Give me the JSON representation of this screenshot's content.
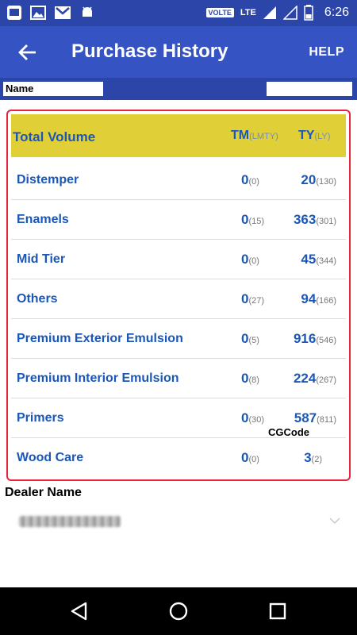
{
  "status_bar": {
    "volte": "VOLTE",
    "network": "LTE",
    "time": "6:26"
  },
  "app_bar": {
    "title": "Purchase History",
    "help_label": "HELP"
  },
  "name_field": {
    "label": "Name"
  },
  "table": {
    "header": {
      "label": "Total Volume",
      "tm": "TM",
      "tm_sub": "(LMTY)",
      "ty": "TY",
      "ty_sub": "(LY)"
    },
    "rows": [
      {
        "label": "Distemper",
        "tm": "0",
        "tm_sub": "(0)",
        "ty": "20",
        "ty_sub": "(130)"
      },
      {
        "label": "Enamels",
        "tm": "0",
        "tm_sub": "(15)",
        "ty": "363",
        "ty_sub": "(301)"
      },
      {
        "label": "Mid Tier",
        "tm": "0",
        "tm_sub": "(0)",
        "ty": "45",
        "ty_sub": "(344)"
      },
      {
        "label": "Others",
        "tm": "0",
        "tm_sub": "(27)",
        "ty": "94",
        "ty_sub": "(166)"
      },
      {
        "label": "Premium Exterior Emulsion",
        "tm": "0",
        "tm_sub": "(5)",
        "ty": "916",
        "ty_sub": "(546)"
      },
      {
        "label": "Premium Interior Emulsion",
        "tm": "0",
        "tm_sub": "(8)",
        "ty": "224",
        "ty_sub": "(267)"
      },
      {
        "label": "Primers",
        "tm": "0",
        "tm_sub": "(30)",
        "ty": "587",
        "ty_sub": "(811)"
      },
      {
        "label": "Wood Care",
        "tm": "0",
        "tm_sub": "(0)",
        "ty": "3",
        "ty_sub": "(2)"
      }
    ]
  },
  "watermark": "CGCode",
  "dealer": {
    "label": "Dealer Name"
  },
  "colors": {
    "status_bar": "#2c45a8",
    "app_bar": "#3553c3",
    "header_fill": "#e1cf38",
    "accent_text": "#1a57b8",
    "card_border": "#e8243c"
  },
  "icons": {
    "back": "arrow-left-icon",
    "chevron": "chevron-down-icon",
    "nav_back": "triangle-back-icon",
    "nav_home": "circle-home-icon",
    "nav_recent": "square-recents-icon"
  }
}
